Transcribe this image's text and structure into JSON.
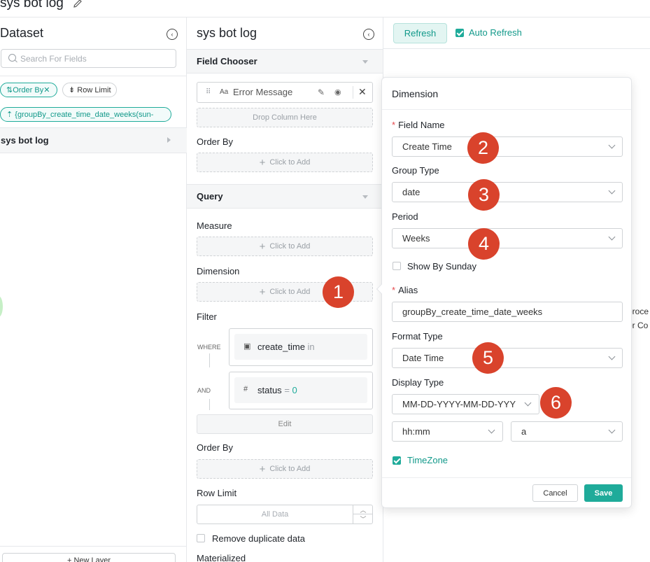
{
  "top": {
    "title": "sys bot log"
  },
  "left": {
    "title": "Dataset",
    "search_placeholder": "Search For Fields",
    "pills": {
      "order_by": "⇅Order By✕",
      "row_limit": "⇟ Row Limit",
      "group_by": "⇡ {groupBy_create_time_date_weeks(sun-"
    },
    "tables": [
      "sys bot log"
    ],
    "new_layer": "+ New Layer"
  },
  "middle": {
    "title": "sys bot log",
    "field_chooser": {
      "label": "Field Chooser",
      "column_type": "Aa",
      "column": "Error Message",
      "drop_hint": "Drop Column Here",
      "order_by": "Order By",
      "click_to_add": "Click to Add"
    },
    "query": {
      "label": "Query",
      "measure": "Measure",
      "dimension": "Dimension",
      "filter": "Filter",
      "filters": [
        {
          "keyword": "WHERE",
          "icon": "▣",
          "field": "create_time",
          "op": "in",
          "value": ""
        },
        {
          "keyword": "AND",
          "icon": "#",
          "field": "status",
          "op": "=",
          "value": "0"
        }
      ],
      "edit": "Edit",
      "order_by": "Order By",
      "row_limit": "Row Limit",
      "row_limit_placeholder": "All Data",
      "remove_duplicates": "Remove duplicate data",
      "materialized": "Materialized",
      "plus": "+"
    }
  },
  "right": {
    "refresh": "Refresh",
    "auto_refresh": "Auto Refresh",
    "auto_refresh_checked": true,
    "bg_text_1": "proce",
    "bg_text_2": "or Co"
  },
  "dimension_popover": {
    "title": "Dimension",
    "field_name": {
      "label": "Field Name",
      "required_mark": "*",
      "value": "Create Time"
    },
    "group_type": {
      "label": "Group Type",
      "value": "date"
    },
    "period": {
      "label": "Period",
      "value": "Weeks"
    },
    "show_by_sunday": {
      "label": "Show By Sunday",
      "checked": false
    },
    "alias": {
      "label": "Alias",
      "required_mark": "*",
      "value": "groupBy_create_time_date_weeks"
    },
    "format_type": {
      "label": "Format Type",
      "value": "Date Time"
    },
    "display_type": {
      "label": "Display Type",
      "date_format": "MM-DD-YYYY-MM-DD-YYY",
      "time_format": "hh:mm",
      "ampm": "a"
    },
    "timezone": {
      "label": "TimeZone",
      "checked": true
    },
    "cancel": "Cancel",
    "save": "Save"
  },
  "annotations": [
    "1",
    "2",
    "3",
    "4",
    "5",
    "6"
  ],
  "colors": {
    "accent": "#1fab9a",
    "badge": "#d9432c",
    "required": "#e5484d"
  }
}
